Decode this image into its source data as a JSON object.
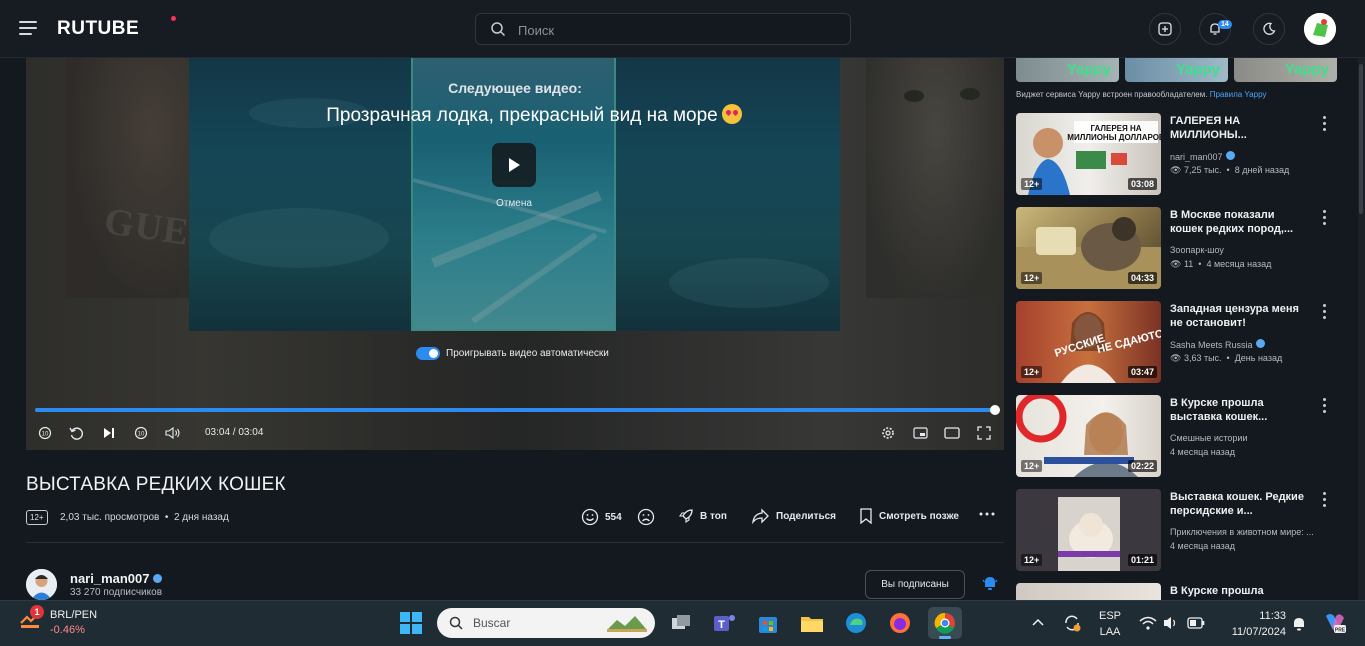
{
  "header": {
    "logo": "RUTUBE",
    "search_placeholder": "Поиск",
    "notifications_count": "14"
  },
  "player": {
    "next_label": "Следующее видео:",
    "next_title": "Прозрачная лодка, прекрасный вид на море",
    "cancel_label": "Отмена",
    "autoplay_label": "Проигрывать видео автоматически",
    "autoplay_on": true,
    "time": "03:04 / 03:04",
    "progress": 1.0
  },
  "video": {
    "title": "ВЫСТАВКА РЕДКИХ КОШЕК",
    "age": "12+",
    "views": "2,03 тыс. просмотров",
    "date": "2 дня назад",
    "likes": "554",
    "top_label": "В топ",
    "share_label": "Поделиться",
    "later_label": "Смотреть позже"
  },
  "channel": {
    "name": "nari_man007",
    "subscribers": "33 270 подписчиков",
    "subscribed_label": "Вы подписаны"
  },
  "sidebar": {
    "yappy_brand": "Yappy",
    "yappy_note": "Виджет сервиса Yappy встроен правообладателем.",
    "yappy_rules": "Правила Yappy",
    "items": [
      {
        "title": "ГАЛЕРЕЯ НА МИЛЛИОНЫ...",
        "channel": "nari_man007",
        "verified": true,
        "views": "7,25 тыс.",
        "date": "8 дней назад",
        "age": "12+",
        "duration": "03:08",
        "thumb_text": "ГАЛЕРЕЯ НА МИЛЛИОНЫ ДОЛЛАРОВ"
      },
      {
        "title": "В Москве показали кошек редких пород,...",
        "channel": "Зоопарк-шоу",
        "verified": false,
        "views": "11",
        "date": "4 месяца назад",
        "age": "12+",
        "duration": "04:33",
        "thumb_text": ""
      },
      {
        "title": "Западная цензура меня не остановит!",
        "channel": "Sasha Meets Russia",
        "verified": true,
        "views": "3,63 тыс.",
        "date": "День назад",
        "age": "12+",
        "duration": "03:47",
        "thumb_text": "РУССКИЕ НЕ СДАЮТСЯ"
      },
      {
        "title": "В Курске прошла выставка кошек...",
        "channel": "Смешные истории",
        "verified": false,
        "views": "",
        "date": "4 месяца назад",
        "age": "12+",
        "duration": "02:22",
        "thumb_text": ""
      },
      {
        "title": "Выставка кошек. Редкие персидские и...",
        "channel": "Приключения в животном мире: ...",
        "verified": false,
        "views": "",
        "date": "4 месяца назад",
        "age": "12+",
        "duration": "01:21",
        "thumb_text": ""
      },
      {
        "title": "В Курске прошла",
        "channel": "",
        "verified": false,
        "views": "",
        "date": "",
        "age": "",
        "duration": "",
        "thumb_text": ""
      }
    ]
  },
  "taskbar": {
    "widget_badge": "1",
    "pair": "BRL/PEN",
    "change": "-0.46%",
    "search_label": "Buscar",
    "lang_top": "ESP",
    "lang_bottom": "LAA",
    "time": "11:33",
    "date": "11/07/2024"
  },
  "colors": {
    "accent": "#2c8bf0",
    "background": "#14191f",
    "yappy_green": "#3ee08c"
  }
}
